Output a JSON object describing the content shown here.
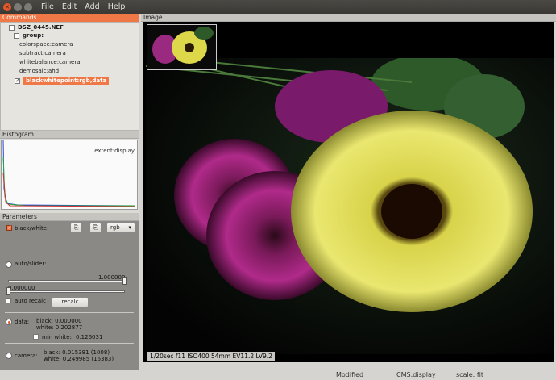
{
  "window": {
    "menu": [
      "File",
      "Edit",
      "Add",
      "Help"
    ]
  },
  "commands": {
    "header": "Commands",
    "file": "DSZ_0445.NEF",
    "group": "group:",
    "items": [
      "colorspace:camera",
      "subtract:camera",
      "whitebalance:camera",
      "demosaic:ahd"
    ],
    "selected": "blackwhitepoint:rgb,data"
  },
  "histogram": {
    "header": "Histogram",
    "extent": "extent:display"
  },
  "parameters": {
    "header": "Parameters",
    "black_white_label": "black/white:",
    "mode_select": "rgb",
    "auto_slider_label": "auto/slider:",
    "slider_high": "1.000000",
    "slider_low": "0.000000",
    "auto_recalc_label": "auto recalc",
    "recalc_button": "recalc",
    "data_label": "data:",
    "data_black": "black: 0.000000",
    "data_white": "white: 0.202877",
    "min_white_label": "min white:",
    "min_white_value": "0.126031",
    "camera_label": "camera:",
    "camera_black": "black: 0.015381 (1008)",
    "camera_white": "white: 0.249985 (16383)"
  },
  "image_panel": {
    "header": "Image",
    "exif": "1/20sec  f11  ISO400  54mm  EV11.2 LV9.2"
  },
  "status": {
    "modified": "Modified",
    "cms": "CMS:display",
    "scale": "scale: fit"
  },
  "colors": {
    "accent": "#f07746",
    "titlebar": "#3c3b37",
    "params_bg": "#8a8985"
  }
}
